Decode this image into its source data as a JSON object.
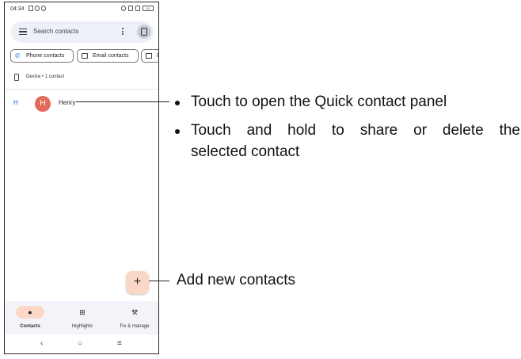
{
  "status_bar": {
    "time": "04:34",
    "battery": "61"
  },
  "search": {
    "placeholder": "Search contacts"
  },
  "filter_chips": [
    {
      "label": "Phone contacts"
    },
    {
      "label": "Email contacts"
    },
    {
      "label": "C"
    }
  ],
  "section": {
    "label": "Device • 1 contact"
  },
  "contacts": [
    {
      "group_letter": "H",
      "initial": "H",
      "name": "Henry",
      "avatar_color": "#e46a5a"
    }
  ],
  "fab": {
    "label": "+"
  },
  "bottom_nav": [
    {
      "label": "Contacts",
      "icon": "person-icon",
      "active": true
    },
    {
      "label": "Highlights",
      "icon": "highlights-icon",
      "active": false
    },
    {
      "label": "Fix & manage",
      "icon": "wrench-icon",
      "active": false
    }
  ],
  "system_nav": {
    "back": "‹",
    "home": "○",
    "recents": "≡"
  },
  "annotations": {
    "tap": "Touch to open the Quick contact panel",
    "hold_line1": "Touch and hold to share or delete the",
    "hold_line2": "selected contact",
    "add": "Add new contacts"
  },
  "colors": {
    "accent": "#fbd7c8",
    "search_bg": "#edf0f6",
    "nav_bg": "#f3f4fa",
    "link_blue": "#1967d2"
  }
}
